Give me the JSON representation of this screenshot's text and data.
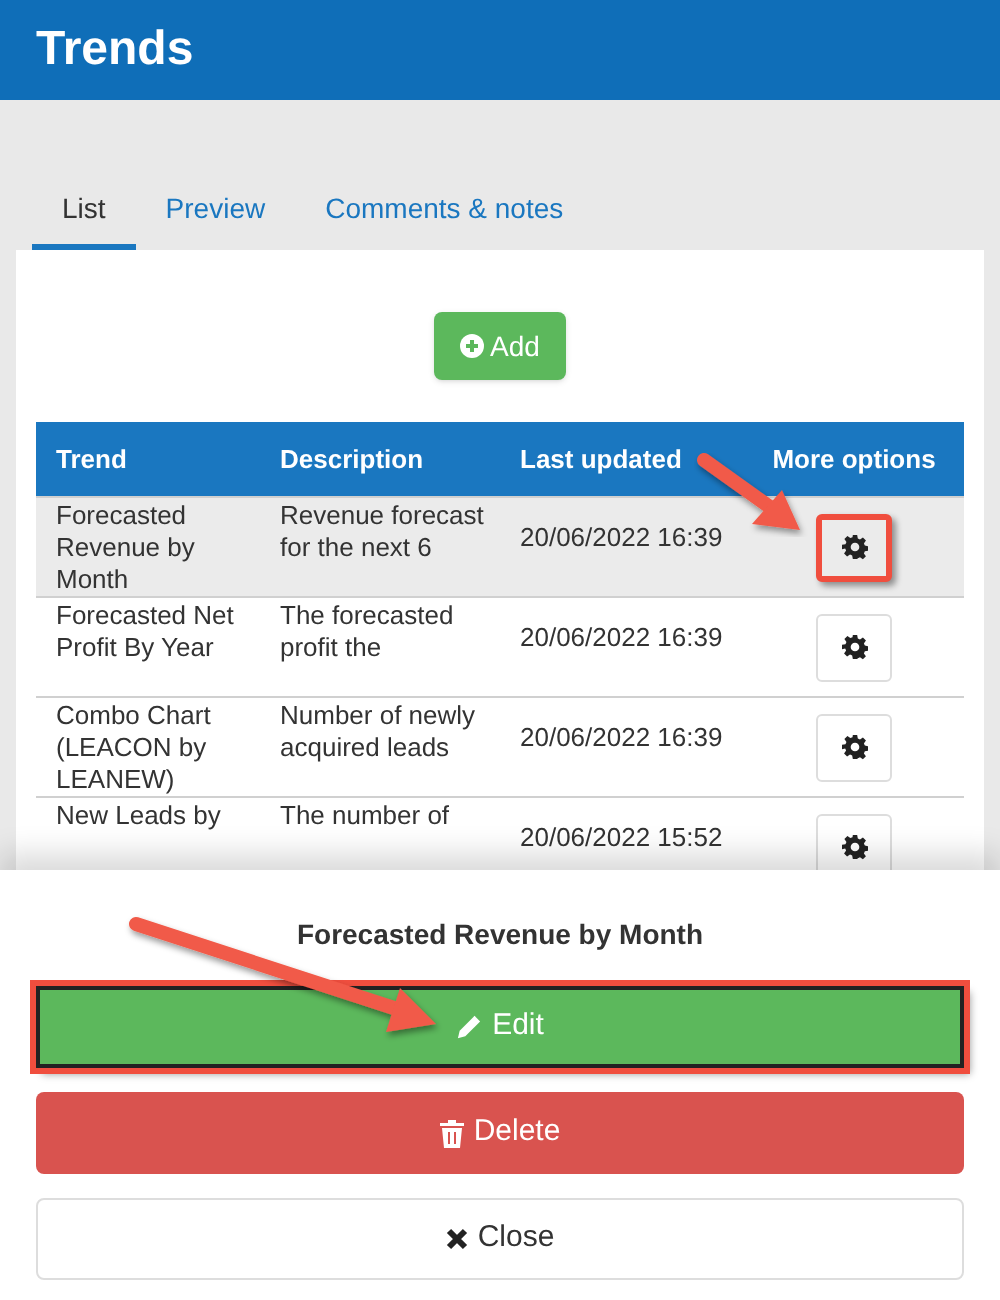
{
  "header": {
    "title": "Trends"
  },
  "tabs": [
    {
      "label": "List",
      "selected": true
    },
    {
      "label": "Preview",
      "selected": false
    },
    {
      "label": "Comments & notes",
      "selected": false
    }
  ],
  "add_button": {
    "label": "Add"
  },
  "table": {
    "columns": [
      "Trend",
      "Description",
      "Last updated",
      "More options"
    ],
    "rows": [
      {
        "trend": "Forecasted Revenue by Month",
        "description": "Revenue forecast for the next 6",
        "last_updated": "20/06/2022 16:39",
        "selected": true,
        "highlighted": true
      },
      {
        "trend": "Forecasted Net Profit By Year",
        "description": "The forecasted profit the",
        "last_updated": "20/06/2022 16:39",
        "selected": false,
        "highlighted": false
      },
      {
        "trend": "Combo Chart (LEACON by LEANEW)",
        "description": "Number of newly acquired leads",
        "last_updated": "20/06/2022 16:39",
        "selected": false,
        "highlighted": false
      },
      {
        "trend": "New Leads by",
        "description": "The number of",
        "last_updated": "20/06/2022 15:52",
        "selected": false,
        "highlighted": false
      }
    ]
  },
  "action_sheet": {
    "title": "Forecasted Revenue by Month",
    "buttons": [
      {
        "kind": "edit",
        "label": "Edit",
        "highlighted": true
      },
      {
        "kind": "delete",
        "label": "Delete",
        "highlighted": false
      },
      {
        "kind": "close",
        "label": "Close",
        "highlighted": false
      }
    ]
  }
}
